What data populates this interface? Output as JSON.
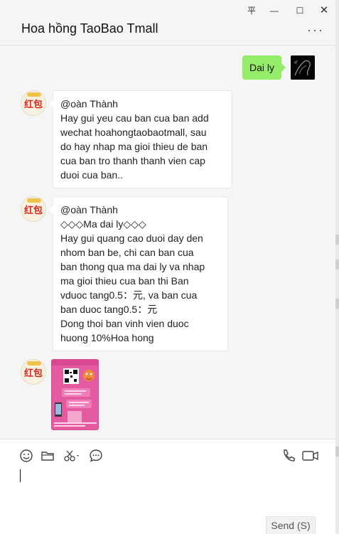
{
  "window": {
    "title": "Hoa hồng TaoBao Tmall",
    "more_label": "···",
    "controls": {
      "pin": "平",
      "minimize": "—",
      "maximize": "☐",
      "close": "✕"
    }
  },
  "messages": {
    "outgoing": {
      "text": "Dai ly"
    },
    "incoming_1": {
      "lines": [
        "@oàn Thành",
        "Hay gui yeu cau ban cua ban add",
        "wechat hoahongtaobaotmall, sau",
        "do hay nhap ma gioi thieu de ban",
        "cua ban tro thanh thanh vien cap",
        "duoi cua ban.."
      ]
    },
    "incoming_2": {
      "lines": [
        "@oàn Thành",
        "◇◇◇Ma dai ly◇◇◇",
        "Hay gui quang cao duoi day den",
        "nhom ban be, chi can ban cua",
        "ban thong qua ma dai ly va nhap",
        "ma gioi thieu cua ban thi Ban",
        "vduoc tang0.5：元, va ban cua",
        "ban duoc tang0.5：元",
        "Dong thoi ban vinh vien duoc",
        "huong 10%Hoa hong"
      ]
    },
    "avatar_label": "红包"
  },
  "composer": {
    "send_label": "Send (S)",
    "tools": [
      "emoji-icon",
      "folder-icon",
      "scissors-icon",
      "chat-history-icon",
      "phone-icon",
      "video-call-icon"
    ]
  },
  "colors": {
    "outgoing_bubble": "#95ec69",
    "incoming_bubble": "#ffffff",
    "background": "#f5f5f5"
  }
}
